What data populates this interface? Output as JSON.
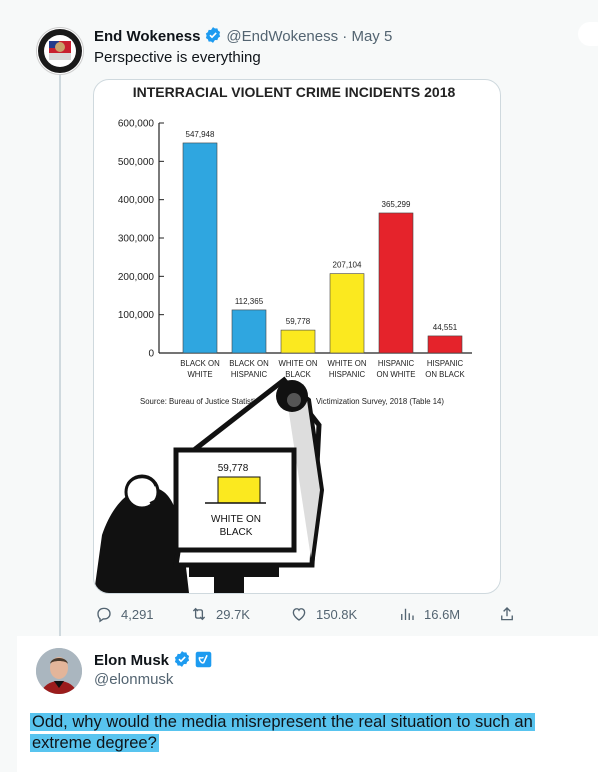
{
  "tweet": {
    "author_name": "End Wokeness",
    "author_handle": "@EndWokeness",
    "separator": "·",
    "date": "May 5",
    "text": "Perspective is everything",
    "stats": {
      "replies": "4,291",
      "retweets": "29.7K",
      "likes": "150.8K",
      "views": "16.6M"
    }
  },
  "image": {
    "title": "INTERRACIAL VIOLENT CRIME INCIDENTS 2018",
    "source": "Source: Bureau of Justice Statistics, N",
    "source_tail": "Victimization Survey, 2018 (Table 14)",
    "monitor_value": "59,778",
    "monitor_label_1": "WHITE ON",
    "monitor_label_2": "BLACK"
  },
  "chart_data": {
    "type": "bar",
    "title": "INTERRACIAL VIOLENT CRIME INCIDENTS 2018",
    "categories": [
      [
        "BLACK ON",
        "WHITE"
      ],
      [
        "BLACK ON",
        "HISPANIC"
      ],
      [
        "WHITE ON",
        "BLACK"
      ],
      [
        "WHITE ON",
        "HISPANIC"
      ],
      [
        "HISPANIC",
        "ON WHITE"
      ],
      [
        "HISPANIC",
        "ON BLACK"
      ]
    ],
    "values": [
      547948,
      112365,
      59778,
      207104,
      365299,
      44551
    ],
    "value_labels": [
      "547,948",
      "112,365",
      "59,778",
      "207,104",
      "365,299",
      "44,551"
    ],
    "colors": [
      "#2fa6e0",
      "#2fa6e0",
      "#fbe91f",
      "#fbe91f",
      "#e5232b",
      "#e5232b"
    ],
    "yticks": [
      "600,000",
      "500,000",
      "400,000",
      "300,000",
      "200,000",
      "100,000",
      "0"
    ],
    "ylim": [
      0,
      600000
    ],
    "grid": false
  },
  "reply": {
    "author_name": "Elon Musk",
    "author_handle": "@elonmusk",
    "text": "Odd, why would the media misrepresent the real situation to such an extreme degree?"
  }
}
